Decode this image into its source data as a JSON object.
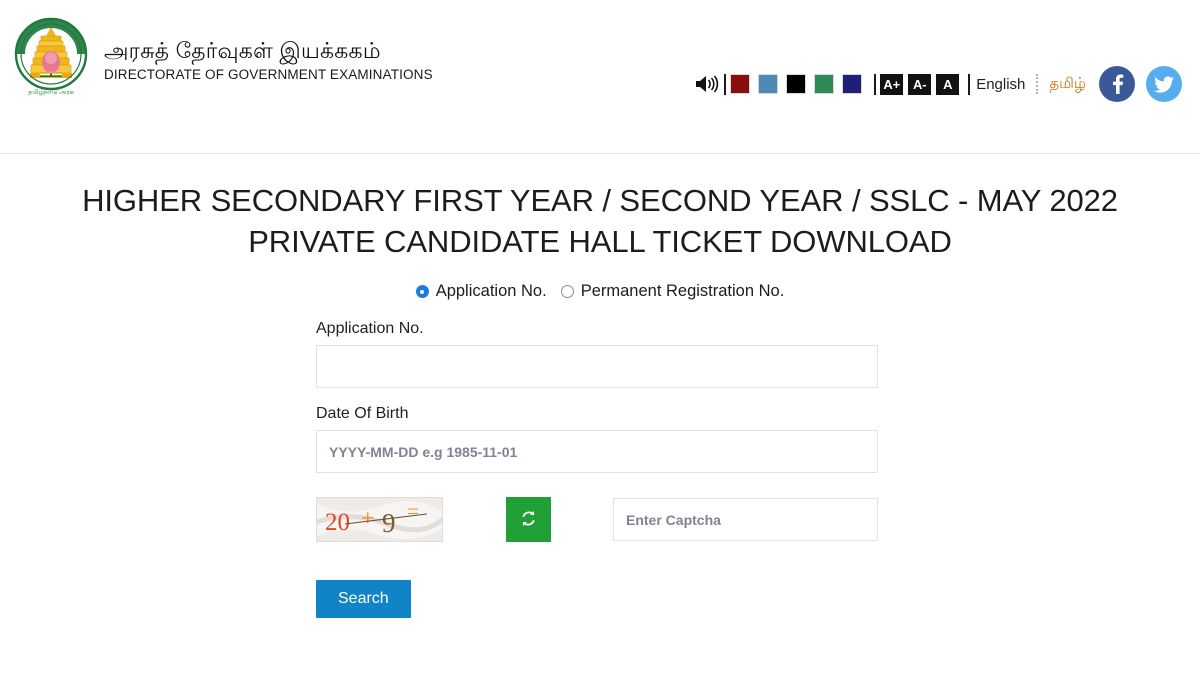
{
  "header": {
    "emblem_icon": "tamil-nadu-government-emblem",
    "org_name_tamil": "அரசுத் தேர்வுகள் இயக்ககம்",
    "org_name_english": "DIRECTORATE OF GOVERNMENT EXAMINATIONS",
    "a11y": {
      "speaker_icon": "speaker-icon",
      "theme_swatches": [
        {
          "name": "dark-red",
          "color": "#8B0D0D"
        },
        {
          "name": "steel-blue",
          "color": "#4E89B8"
        },
        {
          "name": "black",
          "color": "#000000"
        },
        {
          "name": "sea-green",
          "color": "#2E8B57"
        },
        {
          "name": "navy",
          "color": "#1F1F78"
        }
      ],
      "font_increase": "A+",
      "font_decrease": "A-",
      "font_reset": "A",
      "lang_english": "English",
      "lang_tamil": "தமிழ்",
      "facebook_icon": "facebook-icon",
      "twitter_icon": "twitter-icon"
    }
  },
  "main": {
    "title": "HIGHER SECONDARY FIRST YEAR / SECOND YEAR / SSLC - MAY 2022 PRIVATE CANDIDATE HALL TICKET DOWNLOAD",
    "radio_options": [
      {
        "label": "Application No.",
        "selected": true
      },
      {
        "label": "Permanent Registration No.",
        "selected": false
      }
    ],
    "application_no": {
      "label": "Application No.",
      "value": "",
      "placeholder": ""
    },
    "dob": {
      "label": "Date Of Birth",
      "value": "",
      "placeholder": "YYYY-MM-DD e.g 1985-11-01"
    },
    "captcha": {
      "image_text": "20 + 9 =",
      "operand_left": "20",
      "operator": "+",
      "operand_right": "9",
      "equals": "=",
      "refresh_icon": "refresh-icon",
      "input_value": "",
      "input_placeholder": "Enter Captcha"
    },
    "search_label": "Search"
  },
  "colors": {
    "accent_blue": "#1184c7",
    "captcha_green": "#21a038",
    "radio_blue": "#1f7ae0",
    "facebook": "#3b5998",
    "twitter": "#55acee",
    "tamil_link": "#c8730e"
  }
}
